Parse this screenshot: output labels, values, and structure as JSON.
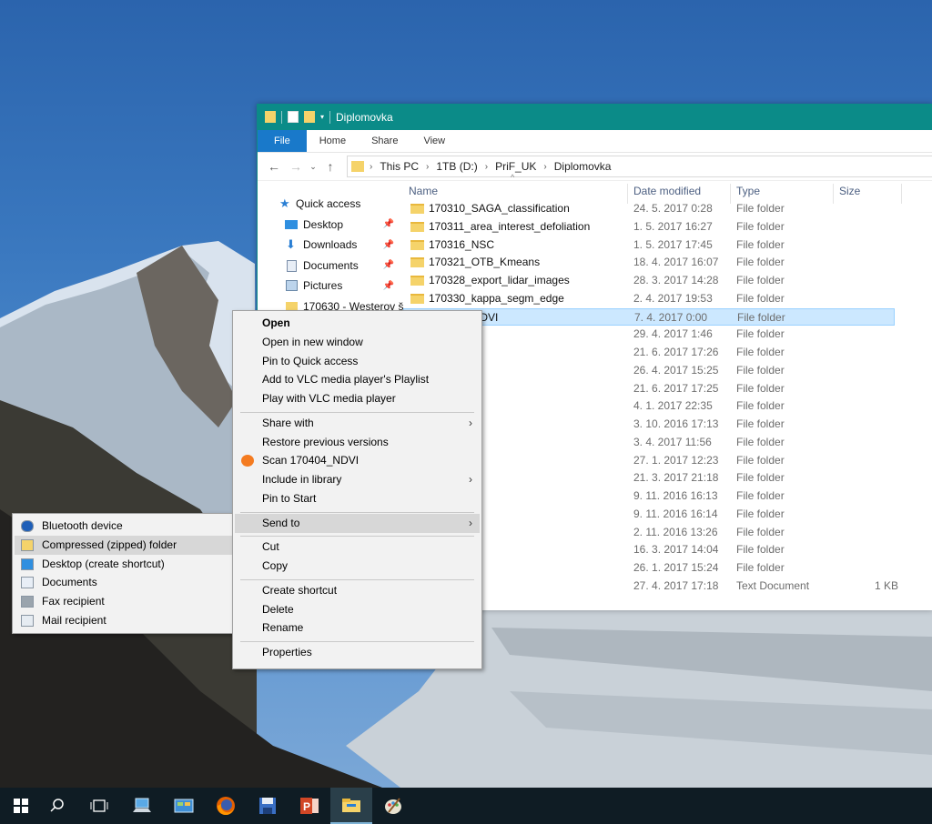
{
  "window": {
    "title": "Diplomovka",
    "ribbon_tabs": [
      "File",
      "Home",
      "Share",
      "View"
    ],
    "breadcrumb": [
      "This PC",
      "1TB (D:)",
      "PriF_UK",
      "Diplomovka"
    ]
  },
  "navigation": {
    "items": [
      {
        "label": "Quick access",
        "icon": "star-icon",
        "pinned": false
      },
      {
        "label": "Desktop",
        "icon": "desktop-icon",
        "pinned": true
      },
      {
        "label": "Downloads",
        "icon": "download-icon",
        "pinned": true
      },
      {
        "label": "Documents",
        "icon": "documents-icon",
        "pinned": true
      },
      {
        "label": "Pictures",
        "icon": "pictures-icon",
        "pinned": true
      },
      {
        "label": "170630 - Westerov š",
        "icon": "folder-icon",
        "pinned": false
      }
    ]
  },
  "columns": {
    "name": "Name",
    "date": "Date modified",
    "type": "Type",
    "size": "Size"
  },
  "files": [
    {
      "name": "170310_SAGA_classification",
      "date": "24. 5. 2017 0:28",
      "type": "File folder",
      "size": ""
    },
    {
      "name": "170311_area_interest_defoliation",
      "date": "1. 5. 2017 16:27",
      "type": "File folder",
      "size": ""
    },
    {
      "name": "170316_NSC",
      "date": "1. 5. 2017 17:45",
      "type": "File folder",
      "size": ""
    },
    {
      "name": "170321_OTB_Kmeans",
      "date": "18. 4. 2017 16:07",
      "type": "File folder",
      "size": ""
    },
    {
      "name": "170328_export_lidar_images",
      "date": "28. 3. 2017 14:28",
      "type": "File folder",
      "size": ""
    },
    {
      "name": "170330_kappa_segm_edge",
      "date": "2. 4. 2017 19:53",
      "type": "File folder",
      "size": ""
    },
    {
      "name": "170404_NDVI",
      "date": "7. 4. 2017 0:00",
      "type": "File folder",
      "size": "",
      "selected": true
    },
    {
      "name": "ecognition",
      "date": "29. 4. 2017 1:46",
      "type": "File folder",
      "size": ""
    },
    {
      "name": "esie",
      "date": "21. 6. 2017 17:26",
      "type": "File folder",
      "size": ""
    },
    {
      "name": "",
      "date": "26. 4. 2017 15:25",
      "type": "File folder",
      "size": ""
    },
    {
      "name": "edky",
      "date": "21. 6. 2017 17:25",
      "type": "File folder",
      "size": ""
    },
    {
      "name": "",
      "date": "4. 1. 2017 22:35",
      "type": "File folder",
      "size": ""
    },
    {
      "name": "",
      "date": "3. 10. 2016 17:13",
      "type": "File folder",
      "size": ""
    },
    {
      "name": "",
      "date": "3. 4. 2017 11:56",
      "type": "File folder",
      "size": ""
    },
    {
      "name": "",
      "date": "27. 1. 2017 12:23",
      "type": "File folder",
      "size": ""
    },
    {
      "name": "ar",
      "date": "21. 3. 2017 21:18",
      "type": "File folder",
      "size": ""
    },
    {
      "name": "",
      "date": "9. 11. 2016 16:13",
      "type": "File folder",
      "size": ""
    },
    {
      "name": "",
      "date": "9. 11. 2016 16:14",
      "type": "File folder",
      "size": ""
    },
    {
      "name": "ochy",
      "date": "2. 11. 2016 13:26",
      "type": "File folder",
      "size": ""
    },
    {
      "name": "",
      "date": "16. 3. 2017 14:04",
      "type": "File folder",
      "size": ""
    },
    {
      "name": "",
      "date": "26. 1. 2017 15:24",
      "type": "File folder",
      "size": ""
    },
    {
      "name": "",
      "date": "27. 4. 2017 17:18",
      "type": "Text Document",
      "size": "1 KB"
    }
  ],
  "context_menu": {
    "items": [
      {
        "label": "Open",
        "bold": true
      },
      {
        "label": "Open in new window"
      },
      {
        "label": "Pin to Quick access"
      },
      {
        "label": "Add to VLC media player's Playlist"
      },
      {
        "label": "Play with VLC media player"
      },
      {
        "separator": true
      },
      {
        "label": "Share with",
        "submenu": true
      },
      {
        "label": "Restore previous versions"
      },
      {
        "label": "Scan 170404_NDVI",
        "icon": "avast-icon"
      },
      {
        "label": "Include in library",
        "submenu": true
      },
      {
        "label": "Pin to Start"
      },
      {
        "separator": true
      },
      {
        "label": "Send to",
        "submenu": true,
        "highlighted": true
      },
      {
        "separator": true
      },
      {
        "label": "Cut"
      },
      {
        "label": "Copy"
      },
      {
        "separator": true
      },
      {
        "label": "Create shortcut"
      },
      {
        "label": "Delete"
      },
      {
        "label": "Rename"
      },
      {
        "separator": true
      },
      {
        "label": "Properties"
      }
    ]
  },
  "send_to_menu": {
    "items": [
      {
        "label": "Bluetooth device",
        "icon": "bluetooth-icon"
      },
      {
        "label": "Compressed (zipped) folder",
        "icon": "zip-folder-icon",
        "highlighted": true
      },
      {
        "label": "Desktop (create shortcut)",
        "icon": "desktop-icon"
      },
      {
        "label": "Documents",
        "icon": "documents-icon"
      },
      {
        "label": "Fax recipient",
        "icon": "fax-icon"
      },
      {
        "label": "Mail recipient",
        "icon": "mail-icon"
      }
    ]
  },
  "taskbar": {
    "items": [
      "start-icon",
      "search-icon",
      "task-view-icon",
      "network-laptop-icon",
      "control-panel-icon",
      "firefox-icon",
      "save-disk-icon",
      "powerpoint-icon",
      "file-explorer-icon",
      "paint-icon"
    ],
    "active": "file-explorer-icon"
  },
  "colors": {
    "titlebar": "#0b8b88",
    "file_tab": "#1979ca",
    "selection": "#cce8ff",
    "taskbar": "#0f1c24"
  }
}
